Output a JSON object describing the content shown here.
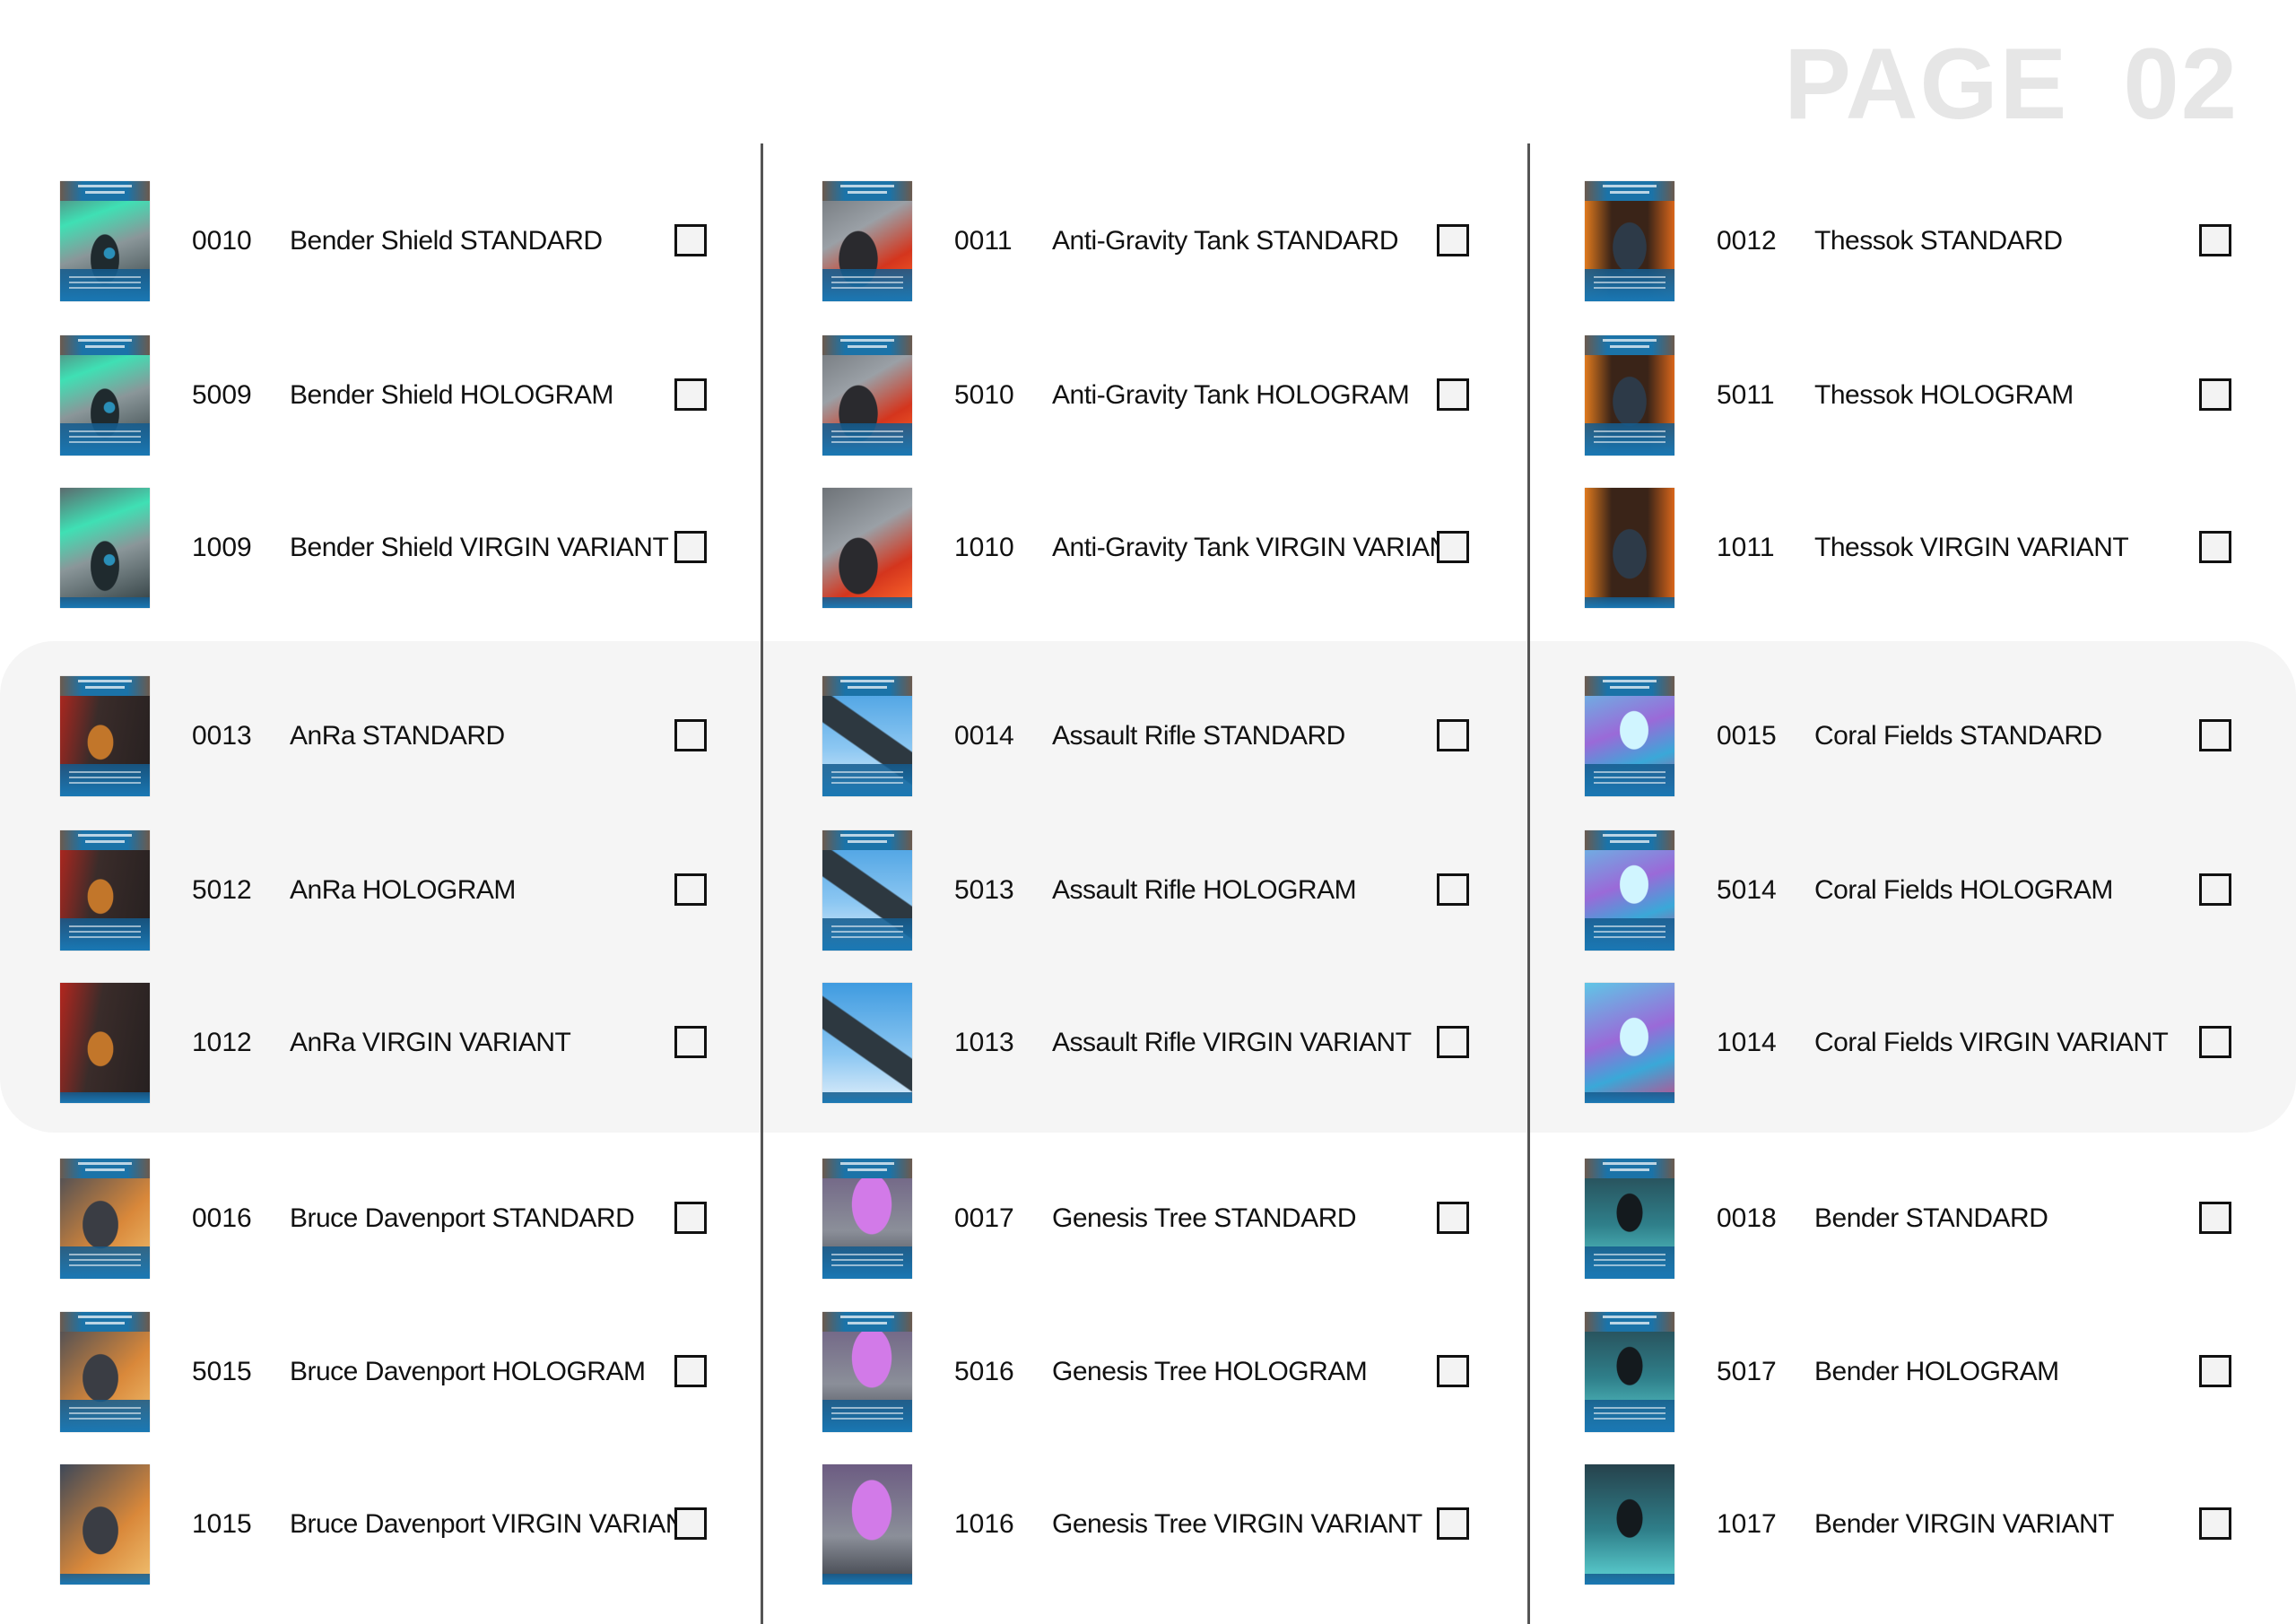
{
  "page_title": "PAGE 02",
  "colors": {
    "band": "#f5f5f5",
    "title": "#e6e6e6",
    "divider": "#555555",
    "card_frame": "#1a78b4"
  },
  "columns": [
    {
      "groups": [
        {
          "items": [
            {
              "code": "0010",
              "name": "Bender Shield STANDARD",
              "variant": "standard",
              "art": "bender-shield",
              "checked": false
            },
            {
              "code": "5009",
              "name": "Bender Shield HOLOGRAM",
              "variant": "hologram",
              "art": "bender-shield",
              "checked": false
            },
            {
              "code": "1009",
              "name": "Bender Shield VIRGIN VARIANT",
              "variant": "virgin",
              "art": "bender-shield",
              "checked": false
            }
          ]
        },
        {
          "items": [
            {
              "code": "0013",
              "name": "AnRa STANDARD",
              "variant": "standard",
              "art": "anra",
              "checked": false
            },
            {
              "code": "5012",
              "name": "AnRa HOLOGRAM",
              "variant": "hologram",
              "art": "anra",
              "checked": false
            },
            {
              "code": "1012",
              "name": "AnRa VIRGIN VARIANT",
              "variant": "virgin",
              "art": "anra",
              "checked": false
            }
          ]
        },
        {
          "items": [
            {
              "code": "0016",
              "name": "Bruce Davenport STANDARD",
              "variant": "standard",
              "art": "bruce",
              "checked": false
            },
            {
              "code": "5015",
              "name": "Bruce Davenport HOLOGRAM",
              "variant": "hologram",
              "art": "bruce",
              "checked": false
            },
            {
              "code": "1015",
              "name": "Bruce Davenport VIRGIN VARIANT",
              "variant": "virgin",
              "art": "bruce",
              "checked": false
            }
          ]
        }
      ]
    },
    {
      "groups": [
        {
          "items": [
            {
              "code": "0011",
              "name": "Anti-Gravity Tank STANDARD",
              "variant": "standard",
              "art": "tank",
              "checked": false
            },
            {
              "code": "5010",
              "name": "Anti-Gravity Tank HOLOGRAM",
              "variant": "hologram",
              "art": "tank",
              "checked": false
            },
            {
              "code": "1010",
              "name": "Anti-Gravity Tank VIRGIN VARIANT",
              "variant": "virgin",
              "art": "tank",
              "checked": false
            }
          ]
        },
        {
          "items": [
            {
              "code": "0014",
              "name": "Assault Rifle STANDARD",
              "variant": "standard",
              "art": "rifle",
              "checked": false
            },
            {
              "code": "5013",
              "name": "Assault Rifle HOLOGRAM",
              "variant": "hologram",
              "art": "rifle",
              "checked": false
            },
            {
              "code": "1013",
              "name": "Assault Rifle VIRGIN VARIANT",
              "variant": "virgin",
              "art": "rifle",
              "checked": false
            }
          ]
        },
        {
          "items": [
            {
              "code": "0017",
              "name": "Genesis Tree STANDARD",
              "variant": "standard",
              "art": "genesis",
              "checked": false
            },
            {
              "code": "5016",
              "name": "Genesis Tree HOLOGRAM",
              "variant": "hologram",
              "art": "genesis",
              "checked": false
            },
            {
              "code": "1016",
              "name": "Genesis Tree VIRGIN VARIANT",
              "variant": "virgin",
              "art": "genesis",
              "checked": false
            }
          ]
        }
      ]
    },
    {
      "groups": [
        {
          "items": [
            {
              "code": "0012",
              "name": "Thessok STANDARD",
              "variant": "standard",
              "art": "thessok",
              "checked": false
            },
            {
              "code": "5011",
              "name": "Thessok HOLOGRAM",
              "variant": "hologram",
              "art": "thessok",
              "checked": false
            },
            {
              "code": "1011",
              "name": "Thessok VIRGIN VARIANT",
              "variant": "virgin",
              "art": "thessok",
              "checked": false
            }
          ]
        },
        {
          "items": [
            {
              "code": "0015",
              "name": "Coral Fields STANDARD",
              "variant": "standard",
              "art": "coral",
              "checked": false
            },
            {
              "code": "5014",
              "name": "Coral Fields HOLOGRAM",
              "variant": "hologram",
              "art": "coral",
              "checked": false
            },
            {
              "code": "1014",
              "name": "Coral Fields VIRGIN VARIANT",
              "variant": "virgin",
              "art": "coral",
              "checked": false
            }
          ]
        },
        {
          "items": [
            {
              "code": "0018",
              "name": "Bender STANDARD",
              "variant": "standard",
              "art": "bender",
              "checked": false
            },
            {
              "code": "5017",
              "name": "Bender HOLOGRAM",
              "variant": "hologram",
              "art": "bender",
              "checked": false
            },
            {
              "code": "1017",
              "name": "Bender VIRGIN VARIANT",
              "variant": "virgin",
              "art": "bender",
              "checked": false
            }
          ]
        }
      ]
    }
  ]
}
